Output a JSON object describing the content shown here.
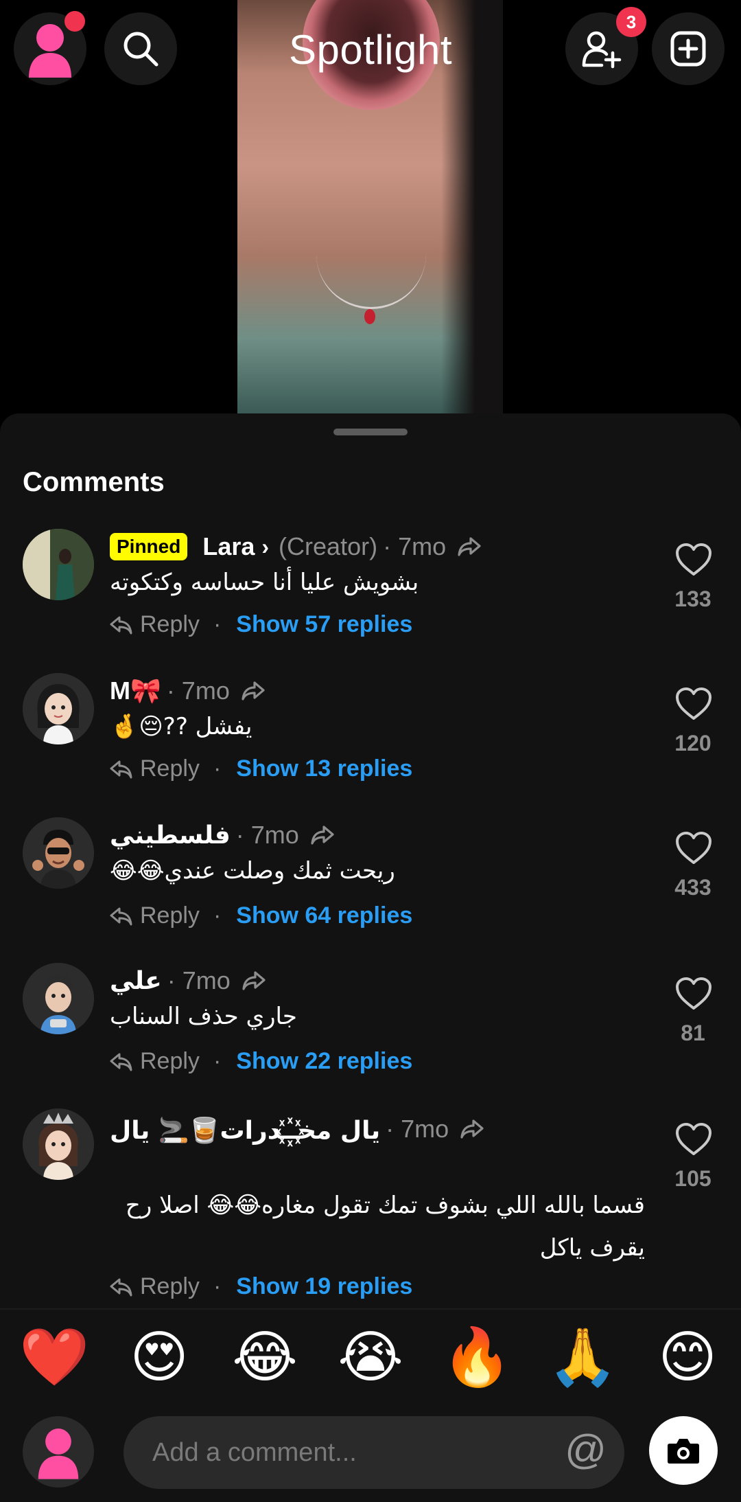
{
  "header": {
    "title": "Spotlight",
    "friend_requests_badge": "3"
  },
  "comments_sheet": {
    "title": "Comments",
    "comments": [
      {
        "pinned_label": "Pinned",
        "username": "Lara",
        "creator_label": "(Creator)",
        "meta": "· 7mo",
        "text": "بشويش عليا أنا حساسه وكتكوته",
        "reply_label": "Reply",
        "show_replies": "Show 57 replies",
        "likes": "133"
      },
      {
        "username": "M🎀",
        "meta": "· 7mo",
        "text": "يفشل ??😔🤞",
        "reply_label": "Reply",
        "show_replies": "Show 13 replies",
        "likes": "120"
      },
      {
        "username": "فلسطيني",
        "meta": "· 7mo",
        "text": "ريحت ثمك وصلت عندي😂😂",
        "reply_label": "Reply",
        "show_replies": "Show 64 replies",
        "likes": "433"
      },
      {
        "username": "علي",
        "meta": "· 7mo",
        "text": "جاري حذف السناب",
        "reply_label": "Reply",
        "show_replies": "Show 22 replies",
        "likes": "81"
      },
      {
        "username": "يال مخـ꙰ـدرات🥃🚬 يال",
        "meta": "· 7mo",
        "text": "قسما بالله اللي بشوف تمك تقول مغاره😂😂 اصلا رح يقرف ياكل",
        "reply_label": "Reply",
        "show_replies": "Show 19 replies",
        "likes": "105"
      }
    ]
  },
  "reactions": [
    "❤️",
    "😍",
    "😂",
    "😭",
    "🔥",
    "🙏",
    "😊"
  ],
  "composer": {
    "placeholder": "Add a comment...",
    "mention_symbol": "@"
  },
  "colors": {
    "accent_blue": "#2a9df4",
    "badge_red": "#f0334f",
    "pinned_yellow": "#fffc00",
    "avatar_pink": "#ff4fa3"
  }
}
